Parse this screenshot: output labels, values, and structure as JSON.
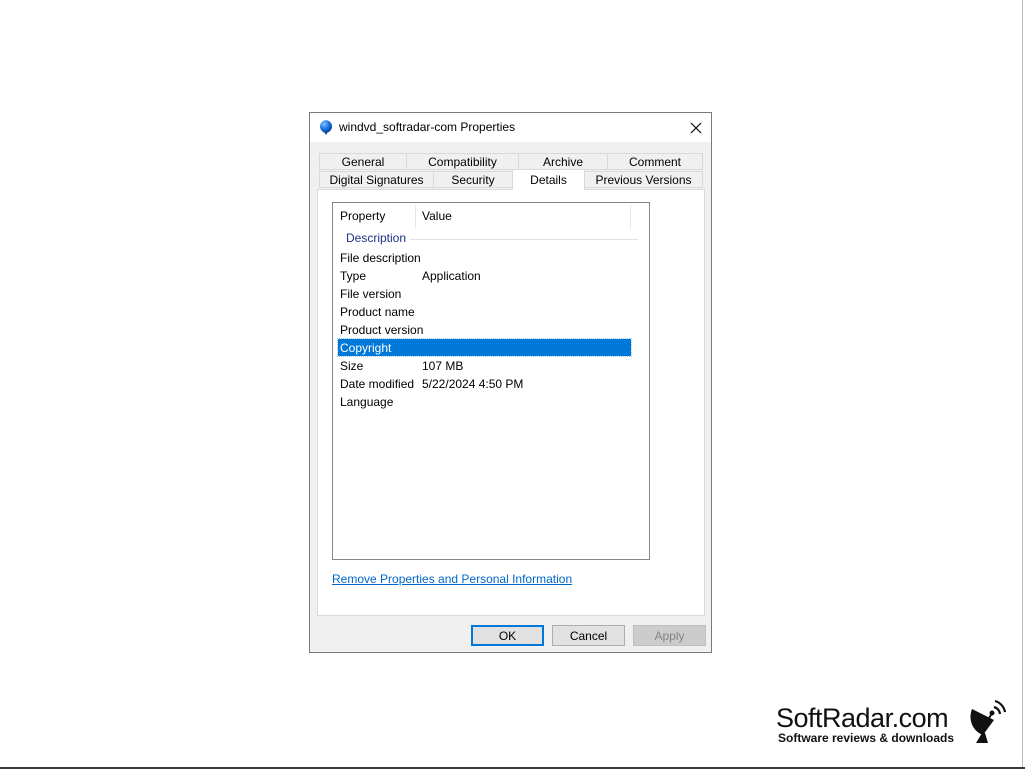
{
  "window": {
    "title": "windvd_softradar-com Properties",
    "icon": "windvd-balloon-icon",
    "close_icon": "close-icon"
  },
  "tabs_row1": [
    {
      "label": "General"
    },
    {
      "label": "Compatibility"
    },
    {
      "label": "Archive"
    },
    {
      "label": "Comment"
    }
  ],
  "tabs_row2": [
    {
      "label": "Digital Signatures"
    },
    {
      "label": "Security"
    },
    {
      "label": "Details",
      "active": true
    },
    {
      "label": "Previous Versions"
    }
  ],
  "details": {
    "columns": {
      "property": "Property",
      "value": "Value"
    },
    "group": "Description",
    "rows": [
      {
        "property": "File description",
        "value": ""
      },
      {
        "property": "Type",
        "value": "Application"
      },
      {
        "property": "File version",
        "value": ""
      },
      {
        "property": "Product name",
        "value": ""
      },
      {
        "property": "Product version",
        "value": ""
      },
      {
        "property": "Copyright",
        "value": "",
        "selected": true
      },
      {
        "property": "Size",
        "value": "107 MB"
      },
      {
        "property": "Date modified",
        "value": "5/22/2024 4:50 PM"
      },
      {
        "property": "Language",
        "value": ""
      }
    ],
    "remove_link": "Remove Properties and Personal Information"
  },
  "buttons": {
    "ok": "OK",
    "cancel": "Cancel",
    "apply": "Apply"
  },
  "watermark": {
    "name": "SoftRadar.com",
    "tagline": "Software reviews & downloads",
    "icon": "satellite-dish-icon"
  },
  "colors": {
    "selection": "#0078d7",
    "link": "#0066cc",
    "group_title": "#1e3287"
  }
}
